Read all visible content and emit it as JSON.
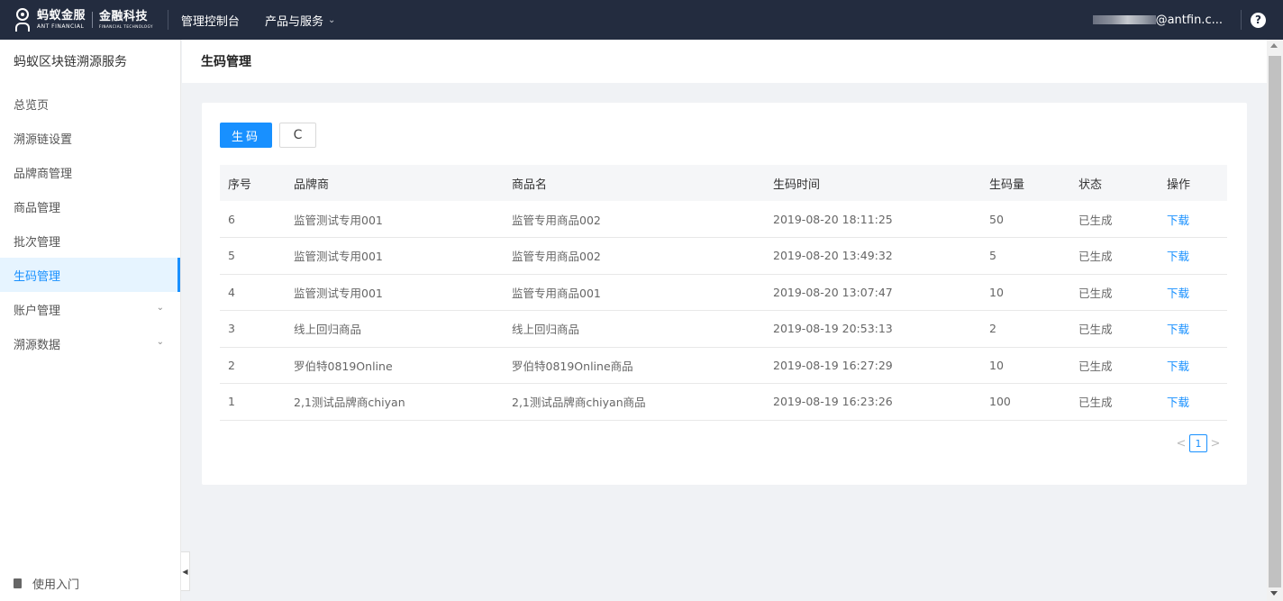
{
  "topbar": {
    "brand_cn": "蚂蚁金服",
    "brand_en": "ANT FINANCIAL",
    "brand2_cn": "金融科技",
    "brand2_en": "FINANCIAL TECHNOLOGY",
    "nav": [
      {
        "label": "管理控制台"
      },
      {
        "label": "产品与服务"
      }
    ],
    "user_email": "@antfin.c...",
    "help_glyph": "?"
  },
  "sidebar": {
    "title": "蚂蚁区块链溯源服务",
    "items": [
      {
        "label": "总览页"
      },
      {
        "label": "溯源链设置"
      },
      {
        "label": "品牌商管理"
      },
      {
        "label": "商品管理"
      },
      {
        "label": "批次管理"
      },
      {
        "label": "生码管理"
      },
      {
        "label": "账户管理"
      },
      {
        "label": "溯源数据"
      }
    ],
    "active_item": "生码管理",
    "bottom_link": "使用入门"
  },
  "page": {
    "title": "生码管理"
  },
  "toolbar": {
    "generate_label": "生码",
    "refresh_glyph": "C"
  },
  "table": {
    "columns": [
      "序号",
      "品牌商",
      "商品名",
      "生码时间",
      "生码量",
      "状态",
      "操作"
    ],
    "rows": [
      {
        "no": "6",
        "brand": "监管测试专用001",
        "product": "监管专用商品002",
        "time": "2019-08-20 18:11:25",
        "qty": "50",
        "status": "已生成",
        "action": "下载"
      },
      {
        "no": "5",
        "brand": "监管测试专用001",
        "product": "监管专用商品002",
        "time": "2019-08-20 13:49:32",
        "qty": "5",
        "status": "已生成",
        "action": "下载"
      },
      {
        "no": "4",
        "brand": "监管测试专用001",
        "product": "监管专用商品001",
        "time": "2019-08-20 13:07:47",
        "qty": "10",
        "status": "已生成",
        "action": "下载"
      },
      {
        "no": "3",
        "brand": "线上回归商品",
        "product": "线上回归商品",
        "time": "2019-08-19 20:53:13",
        "qty": "2",
        "status": "已生成",
        "action": "下载"
      },
      {
        "no": "2",
        "brand": "罗伯特0819Online",
        "product": "罗伯特0819Online商品",
        "time": "2019-08-19 16:27:29",
        "qty": "10",
        "status": "已生成",
        "action": "下载"
      },
      {
        "no": "1",
        "brand": "2,1测试品牌商chiyan",
        "product": "2,1测试品牌商chiyan商品",
        "time": "2019-08-19 16:23:26",
        "qty": "100",
        "status": "已生成",
        "action": "下载"
      }
    ]
  },
  "pagination": {
    "prev_glyph": "<",
    "current_page": "1",
    "next_glyph": ">"
  },
  "colors": {
    "topbar_bg": "#232c3f",
    "accent": "#1890ff",
    "active_bg": "#e6f4ff"
  }
}
